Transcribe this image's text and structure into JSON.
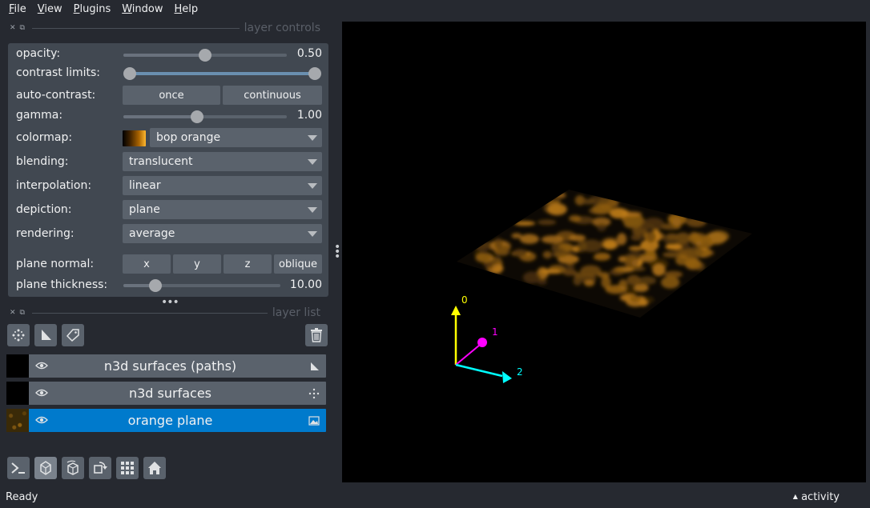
{
  "menu": [
    "File",
    "View",
    "Plugins",
    "Window",
    "Help"
  ],
  "menu_mnemonic": [
    "F",
    "V",
    "P",
    "W",
    "H"
  ],
  "dock_titles": {
    "controls": "layer controls",
    "list": "layer list"
  },
  "controls": {
    "opacity": {
      "label": "opacity:",
      "value": "0.50",
      "fraction": 0.5
    },
    "contrast_limits": {
      "label": "contrast limits:",
      "low": 0.0,
      "high": 1.0
    },
    "auto_contrast": {
      "label": "auto-contrast:",
      "once": "once",
      "continuous": "continuous"
    },
    "gamma": {
      "label": "gamma:",
      "value": "1.00",
      "fraction": 0.45
    },
    "colormap": {
      "label": "colormap:",
      "value": "bop orange"
    },
    "blending": {
      "label": "blending:",
      "value": "translucent"
    },
    "interpolation": {
      "label": "interpolation:",
      "value": "linear"
    },
    "depiction": {
      "label": "depiction:",
      "value": "plane"
    },
    "rendering": {
      "label": "rendering:",
      "value": "average"
    },
    "plane_normal": {
      "label": "plane normal:",
      "buttons": [
        "x",
        "y",
        "z",
        "oblique"
      ]
    },
    "plane_thickness": {
      "label": "plane thickness:",
      "value": "10.00",
      "fraction": 0.2
    }
  },
  "layers": [
    {
      "name": "n3d surfaces (paths)",
      "type": "shapes",
      "selected": false
    },
    {
      "name": "n3d surfaces",
      "type": "points",
      "selected": false
    },
    {
      "name": "orange plane",
      "type": "image",
      "selected": true
    }
  ],
  "axes": {
    "labels": [
      "0",
      "1",
      "2"
    ],
    "colors": [
      "#ffff00",
      "#ff00ff",
      "#00ffff"
    ]
  },
  "status": {
    "text": "Ready",
    "activity": "activity"
  },
  "colors": {
    "background": "#262930",
    "panel": "#414851",
    "widget": "#5a626c",
    "selection": "#007acc"
  }
}
